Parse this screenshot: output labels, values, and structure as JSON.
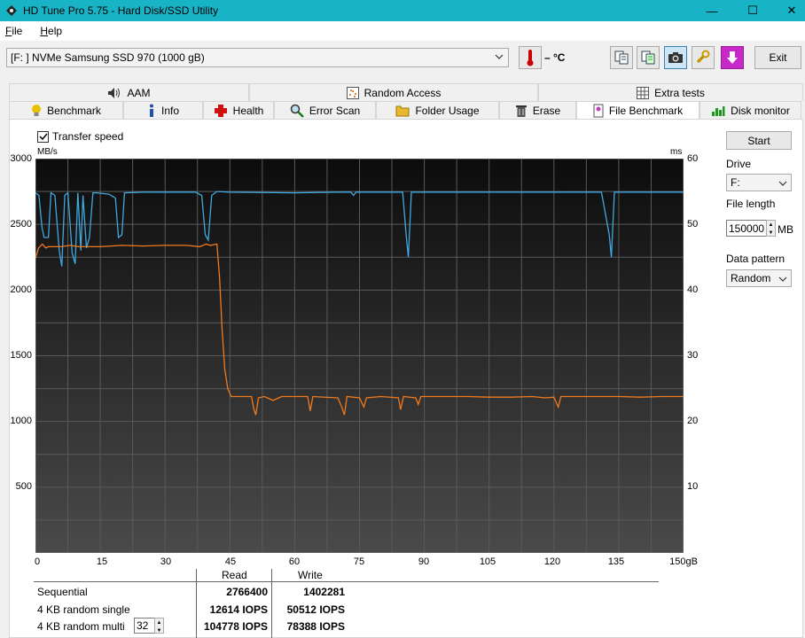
{
  "window": {
    "title": "HD Tune Pro 5.75 - Hard Disk/SSD Utility",
    "minimize": "—",
    "maximize": "☐",
    "close": "✕"
  },
  "menu": {
    "file": "File",
    "help": "Help"
  },
  "toolbar": {
    "drive": "[F: ] NVMe    Samsung SSD 970 (1000 gB)",
    "temperature": "– °C",
    "exit_label": "Exit"
  },
  "tabs_top": [
    {
      "label": "AAM",
      "icon": "speaker-icon"
    },
    {
      "label": "Random Access",
      "icon": "scatter-icon"
    },
    {
      "label": "Extra tests",
      "icon": "grid-icon"
    }
  ],
  "tabs_bottom": [
    {
      "label": "Benchmark",
      "icon": "bulb-icon"
    },
    {
      "label": "Info",
      "icon": "info-icon"
    },
    {
      "label": "Health",
      "icon": "health-cross-icon"
    },
    {
      "label": "Error Scan",
      "icon": "magnifier-icon"
    },
    {
      "label": "Folder Usage",
      "icon": "folder-icon"
    },
    {
      "label": "Erase",
      "icon": "trash-icon"
    },
    {
      "label": "File Benchmark",
      "icon": "file-bench-icon",
      "active": true
    },
    {
      "label": "Disk monitor",
      "icon": "monitor-icon"
    }
  ],
  "options": {
    "transfer_speed_label": "Transfer speed",
    "transfer_speed_checked": true
  },
  "side": {
    "start_label": "Start",
    "drive_label": "Drive",
    "drive_value": "F:",
    "file_length_label": "File length",
    "file_length_value": "150000",
    "file_length_unit": "MB",
    "data_pattern_label": "Data pattern",
    "data_pattern_value": "Random"
  },
  "chart_data": {
    "type": "line",
    "y_left_unit": "MB/s",
    "y_right_unit": "ms",
    "x_unit_suffix": "gB",
    "y_left_ticks": [
      "3000",
      "2500",
      "2000",
      "1500",
      "1000",
      "500"
    ],
    "y_right_ticks": [
      "60",
      "50",
      "40",
      "30",
      "20",
      "10"
    ],
    "x_ticks": [
      "0",
      "15",
      "30",
      "45",
      "60",
      "75",
      "90",
      "105",
      "120",
      "135",
      "150gB"
    ],
    "xlim": [
      0,
      150
    ],
    "ylim": [
      0,
      3000
    ],
    "grid": true,
    "colors": {
      "read": "#40a8e0",
      "write": "#f07a1e",
      "bg_top": "#0c0c0c",
      "bg_bottom": "#4a4a4a",
      "grid": "#5a5a5a"
    },
    "series": [
      {
        "points": [
          [
            0,
            2740
          ],
          [
            0.8,
            2720
          ],
          [
            1.5,
            2480
          ],
          [
            2,
            2400
          ],
          [
            3,
            2400
          ],
          [
            3.6,
            2740
          ],
          [
            4.5,
            2720
          ],
          [
            5.5,
            2300
          ],
          [
            6.1,
            2180
          ],
          [
            6.8,
            2720
          ],
          [
            7.5,
            2740
          ],
          [
            8.5,
            2280
          ],
          [
            9.2,
            2200
          ],
          [
            9.8,
            2740
          ],
          [
            10.5,
            2300
          ],
          [
            11,
            2720
          ],
          [
            11.8,
            2320
          ],
          [
            12.5,
            2400
          ],
          [
            13.3,
            2740
          ],
          [
            14.2,
            2740
          ],
          [
            17,
            2730
          ],
          [
            18.5,
            2700
          ],
          [
            19.2,
            2400
          ],
          [
            20,
            2420
          ],
          [
            20.6,
            2740
          ],
          [
            25,
            2745
          ],
          [
            30,
            2745
          ],
          [
            37,
            2745
          ],
          [
            38.5,
            2720
          ],
          [
            39.3,
            2420
          ],
          [
            40,
            2380
          ],
          [
            40.8,
            2720
          ],
          [
            42,
            2750
          ],
          [
            45,
            2745
          ],
          [
            60,
            2740
          ],
          [
            70,
            2745
          ],
          [
            73,
            2745
          ],
          [
            73.6,
            2720
          ],
          [
            74.2,
            2745
          ],
          [
            80,
            2745
          ],
          [
            85,
            2745
          ],
          [
            85.8,
            2420
          ],
          [
            86.3,
            2250
          ],
          [
            87,
            2745
          ],
          [
            95,
            2745
          ],
          [
            110,
            2745
          ],
          [
            125,
            2745
          ],
          [
            131,
            2745
          ],
          [
            132.8,
            2420
          ],
          [
            133.3,
            2250
          ],
          [
            134,
            2745
          ],
          [
            140,
            2745
          ],
          [
            150,
            2745
          ]
        ]
      },
      {
        "points": [
          [
            0,
            2240
          ],
          [
            0.7,
            2320
          ],
          [
            1.6,
            2350
          ],
          [
            2.4,
            2320
          ],
          [
            3,
            2330
          ],
          [
            6,
            2330
          ],
          [
            8,
            2340
          ],
          [
            10,
            2330
          ],
          [
            12,
            2330
          ],
          [
            15,
            2330
          ],
          [
            20,
            2340
          ],
          [
            25,
            2335
          ],
          [
            30,
            2340
          ],
          [
            35,
            2340
          ],
          [
            38,
            2330
          ],
          [
            39.5,
            2350
          ],
          [
            40.5,
            2340
          ],
          [
            42,
            2350
          ],
          [
            42.6,
            2100
          ],
          [
            43.2,
            1700
          ],
          [
            43.8,
            1400
          ],
          [
            44.5,
            1250
          ],
          [
            45.3,
            1190
          ],
          [
            50,
            1190
          ],
          [
            50.5,
            1100
          ],
          [
            51,
            1050
          ],
          [
            51.6,
            1180
          ],
          [
            53,
            1190
          ],
          [
            55,
            1160
          ],
          [
            57,
            1190
          ],
          [
            63,
            1190
          ],
          [
            63.6,
            1080
          ],
          [
            64.2,
            1190
          ],
          [
            70,
            1180
          ],
          [
            71,
            1100
          ],
          [
            71.5,
            1050
          ],
          [
            72.1,
            1190
          ],
          [
            75,
            1180
          ],
          [
            76,
            1110
          ],
          [
            76.6,
            1180
          ],
          [
            80,
            1190
          ],
          [
            84,
            1180
          ],
          [
            84.5,
            1090
          ],
          [
            85.2,
            1190
          ],
          [
            88,
            1180
          ],
          [
            88.6,
            1130
          ],
          [
            89.2,
            1190
          ],
          [
            100,
            1190
          ],
          [
            105,
            1185
          ],
          [
            110,
            1185
          ],
          [
            115,
            1190
          ],
          [
            118,
            1180
          ],
          [
            120,
            1185
          ],
          [
            121,
            1110
          ],
          [
            121.6,
            1190
          ],
          [
            125,
            1190
          ],
          [
            135,
            1190
          ],
          [
            140,
            1185
          ],
          [
            145,
            1190
          ],
          [
            150,
            1190
          ]
        ]
      }
    ]
  },
  "results": {
    "col_read": "Read",
    "col_write": "Write",
    "rows": [
      {
        "label": "Sequential",
        "read": "2766400",
        "write": "1402281"
      },
      {
        "label": "4 KB random single",
        "read": "12614 IOPS",
        "write": "50512 IOPS"
      },
      {
        "label": "4 KB random multi",
        "read": "104778 IOPS",
        "write": "78388 IOPS",
        "queue": "32"
      }
    ]
  }
}
